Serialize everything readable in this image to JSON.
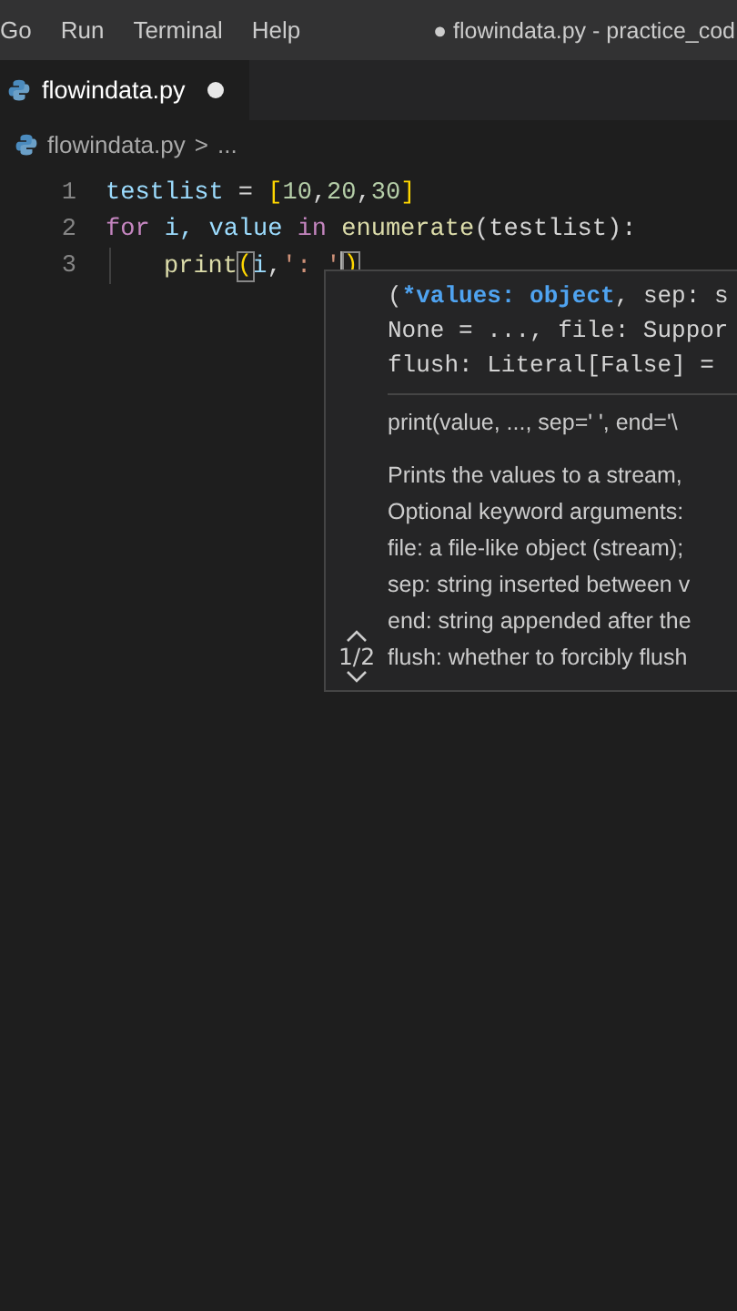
{
  "menu_bar": {
    "items": [
      "Go",
      "Run",
      "Terminal",
      "Help"
    ],
    "title": "● flowindata.py - practice_cod"
  },
  "tabs": [
    {
      "label": "flowindata.py",
      "selected": true,
      "dirty": true
    }
  ],
  "breadcrumb": {
    "file": "flowindata.py",
    "separator": ">",
    "more": "..."
  },
  "editor": {
    "lines": [
      {
        "number": "1",
        "tokens": [
          {
            "kind": "var",
            "text": "testlist"
          },
          {
            "kind": "plain",
            "text": " = "
          },
          {
            "kind": "bracket",
            "text": "["
          },
          {
            "kind": "num",
            "text": "10"
          },
          {
            "kind": "plain",
            "text": ","
          },
          {
            "kind": "num",
            "text": "20"
          },
          {
            "kind": "plain",
            "text": ","
          },
          {
            "kind": "num",
            "text": "30"
          },
          {
            "kind": "bracket",
            "text": "]"
          }
        ]
      },
      {
        "number": "2",
        "tokens": [
          {
            "kind": "keyword",
            "text": "for"
          },
          {
            "kind": "var",
            "text": " i, value "
          },
          {
            "kind": "keyword",
            "text": "in "
          },
          {
            "kind": "fn",
            "text": "enumerate"
          },
          {
            "kind": "plain",
            "text": "(testlist):"
          }
        ]
      },
      {
        "number": "3",
        "indent": true,
        "tokens": [
          {
            "kind": "fn",
            "text": "print"
          },
          {
            "kind": "match",
            "text": "("
          },
          {
            "kind": "var",
            "text": "i"
          },
          {
            "kind": "plain",
            "text": ","
          },
          {
            "kind": "str",
            "text": "': '"
          },
          {
            "kind": "cursor"
          },
          {
            "kind": "match",
            "text": ")"
          }
        ]
      }
    ]
  },
  "signature_help": {
    "overload": "1/2",
    "signature": [
      [
        {
          "kind": "plain",
          "text": "("
        },
        {
          "kind": "param",
          "text": "*values: object"
        },
        {
          "kind": "plain",
          "text": ", sep: s"
        }
      ],
      [
        {
          "kind": "plain",
          "text": "None = ..., file: Suppor"
        }
      ],
      [
        {
          "kind": "plain",
          "text": "flush: Literal[False] ="
        }
      ]
    ],
    "summary": "print(value, ..., sep=' ', end='\\",
    "doc": [
      "Prints the values to a stream,",
      "Optional keyword arguments:",
      "file: a file-like object (stream);",
      "sep: string inserted between v",
      "end: string appended after the",
      "flush: whether to forcibly flush"
    ]
  }
}
